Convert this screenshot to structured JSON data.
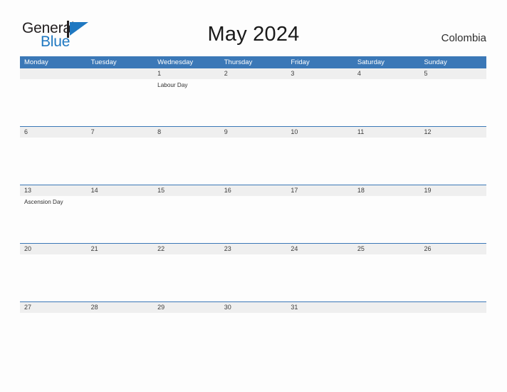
{
  "brand": {
    "name_part1": "General",
    "name_part2": "Blue",
    "color_dark": "#231f20",
    "color_blue": "#1f78c1"
  },
  "header": {
    "title": "May 2024",
    "country": "Colombia"
  },
  "theme": {
    "header_blue": "#3b78b7",
    "date_band_gray": "#efefef",
    "page_background": "#fdfdfd",
    "text_color": "#2f2f2f"
  },
  "calendar": {
    "weekday_headers": [
      "Monday",
      "Tuesday",
      "Wednesday",
      "Thursday",
      "Friday",
      "Saturday",
      "Sunday"
    ],
    "weeks": [
      {
        "days": [
          {
            "date": "",
            "events": []
          },
          {
            "date": "",
            "events": []
          },
          {
            "date": "1",
            "events": [
              "Labour Day"
            ]
          },
          {
            "date": "2",
            "events": []
          },
          {
            "date": "3",
            "events": []
          },
          {
            "date": "4",
            "events": []
          },
          {
            "date": "5",
            "events": []
          }
        ]
      },
      {
        "days": [
          {
            "date": "6",
            "events": []
          },
          {
            "date": "7",
            "events": []
          },
          {
            "date": "8",
            "events": []
          },
          {
            "date": "9",
            "events": []
          },
          {
            "date": "10",
            "events": []
          },
          {
            "date": "11",
            "events": []
          },
          {
            "date": "12",
            "events": []
          }
        ]
      },
      {
        "days": [
          {
            "date": "13",
            "events": [
              "Ascension Day"
            ]
          },
          {
            "date": "14",
            "events": []
          },
          {
            "date": "15",
            "events": []
          },
          {
            "date": "16",
            "events": []
          },
          {
            "date": "17",
            "events": []
          },
          {
            "date": "18",
            "events": []
          },
          {
            "date": "19",
            "events": []
          }
        ]
      },
      {
        "days": [
          {
            "date": "20",
            "events": []
          },
          {
            "date": "21",
            "events": []
          },
          {
            "date": "22",
            "events": []
          },
          {
            "date": "23",
            "events": []
          },
          {
            "date": "24",
            "events": []
          },
          {
            "date": "25",
            "events": []
          },
          {
            "date": "26",
            "events": []
          }
        ]
      },
      {
        "days": [
          {
            "date": "27",
            "events": []
          },
          {
            "date": "28",
            "events": []
          },
          {
            "date": "29",
            "events": []
          },
          {
            "date": "30",
            "events": []
          },
          {
            "date": "31",
            "events": []
          },
          {
            "date": "",
            "events": []
          },
          {
            "date": "",
            "events": []
          }
        ]
      }
    ]
  }
}
